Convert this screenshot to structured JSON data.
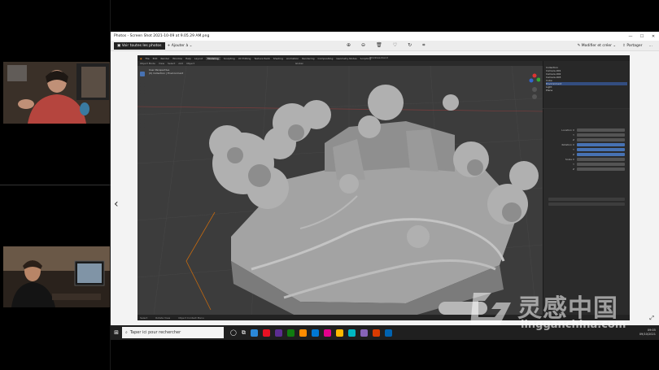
{
  "window": {
    "title": "Photos - Screen Shot 2021-10-09 at 9.05.29 AM.png",
    "controls": [
      "—",
      "☐",
      "✕"
    ]
  },
  "toolbar": {
    "see_all": "Voir toutes les photos",
    "add": "Ajouter à",
    "edit": "Modifier et créer",
    "share": "Partager"
  },
  "blender": {
    "file_title": "Windows.blend",
    "menu": [
      "File",
      "Edit",
      "Render",
      "Window",
      "Help",
      "Layout",
      "Modeling",
      "Sculpting",
      "UV Editing",
      "Texture Paint",
      "Shading",
      "Animation",
      "Rendering",
      "Compositing",
      "Geometry Nodes",
      "Scripting"
    ],
    "active_tab": "Modeling",
    "header_items": [
      "Object Mode",
      "View",
      "Select",
      "Add",
      "Object",
      "Global"
    ],
    "viewport_text": [
      "User Perspective",
      "(0) Collection | Environment"
    ],
    "status": [
      "Select",
      "Rotate View",
      "Object Context Menu"
    ],
    "outliner_rows": [
      "Collection",
      "Camera.001",
      "Camera.002",
      "Camera.003",
      "Cube",
      "Environment",
      "Light",
      "Plane"
    ],
    "props_rows": [
      {
        "label": "Location X"
      },
      {
        "label": "Y"
      },
      {
        "label": "Z"
      },
      {
        "label": "Rotation X"
      },
      {
        "label": "Y"
      },
      {
        "label": "Z"
      },
      {
        "label": "Scale X"
      },
      {
        "label": "Y"
      },
      {
        "label": "Z"
      }
    ]
  },
  "taskbar": {
    "search_placeholder": "Taper ici pour rechercher",
    "time": "09:05",
    "date": "09/10/2021",
    "app_colors": [
      "#2b88d8",
      "#e81123",
      "#5c2d91",
      "#107c10",
      "#ff8c00",
      "#0078d4",
      "#e3008c",
      "#ffb900",
      "#00b7c3",
      "#8764b8",
      "#da3b01",
      "#0063b1"
    ]
  },
  "watermark": {
    "cn": "灵感中国",
    "url": "lingganchina.com"
  }
}
